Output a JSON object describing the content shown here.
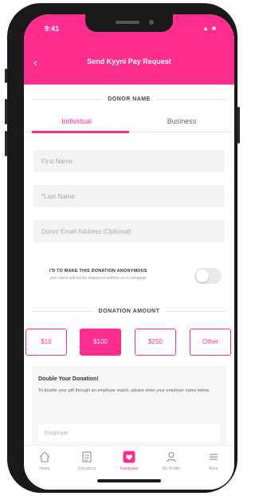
{
  "status_bar": {
    "time": "9:41",
    "icons": "▲ ■"
  },
  "header": {
    "title": "Send Kyyni Pay Request"
  },
  "sections": {
    "donor_name": "DONOR NAME",
    "donation_amount": "DONATION AMOUNT"
  },
  "tabs": [
    {
      "label": "Individual",
      "active": true
    },
    {
      "label": "Business",
      "active": false
    }
  ],
  "fields": {
    "first_name_placeholder": "First Name",
    "last_name_placeholder": "*Last Name",
    "email_placeholder": "Donor Email Address (Optional)"
  },
  "toggle": {
    "title": "I'D TO MAKE THIS DONATION ANONYMOUS",
    "subtitle": "your name will not be displayed publicly on a campaign",
    "on": false
  },
  "amounts": [
    {
      "label": "$10",
      "selected": false
    },
    {
      "label": "$100",
      "selected": true
    },
    {
      "label": "$250",
      "selected": false
    },
    {
      "label": "Other",
      "selected": false
    }
  ],
  "match": {
    "title": "Double Your Donation!",
    "text": "To double your gift through an employer match, please enter your employer name below.",
    "employer_placeholder": "Employer"
  },
  "bottom_nav": [
    {
      "label": "Home",
      "icon": "home-icon"
    },
    {
      "label": "Donations",
      "icon": "list-icon"
    },
    {
      "label": "Fundraise",
      "icon": "heart-icon",
      "active": true
    },
    {
      "label": "My Profile",
      "icon": "user-icon"
    },
    {
      "label": "More",
      "icon": "menu-icon"
    }
  ],
  "colors": {
    "accent": "#ff2d8e",
    "field_bg": "#f3f3f3"
  }
}
